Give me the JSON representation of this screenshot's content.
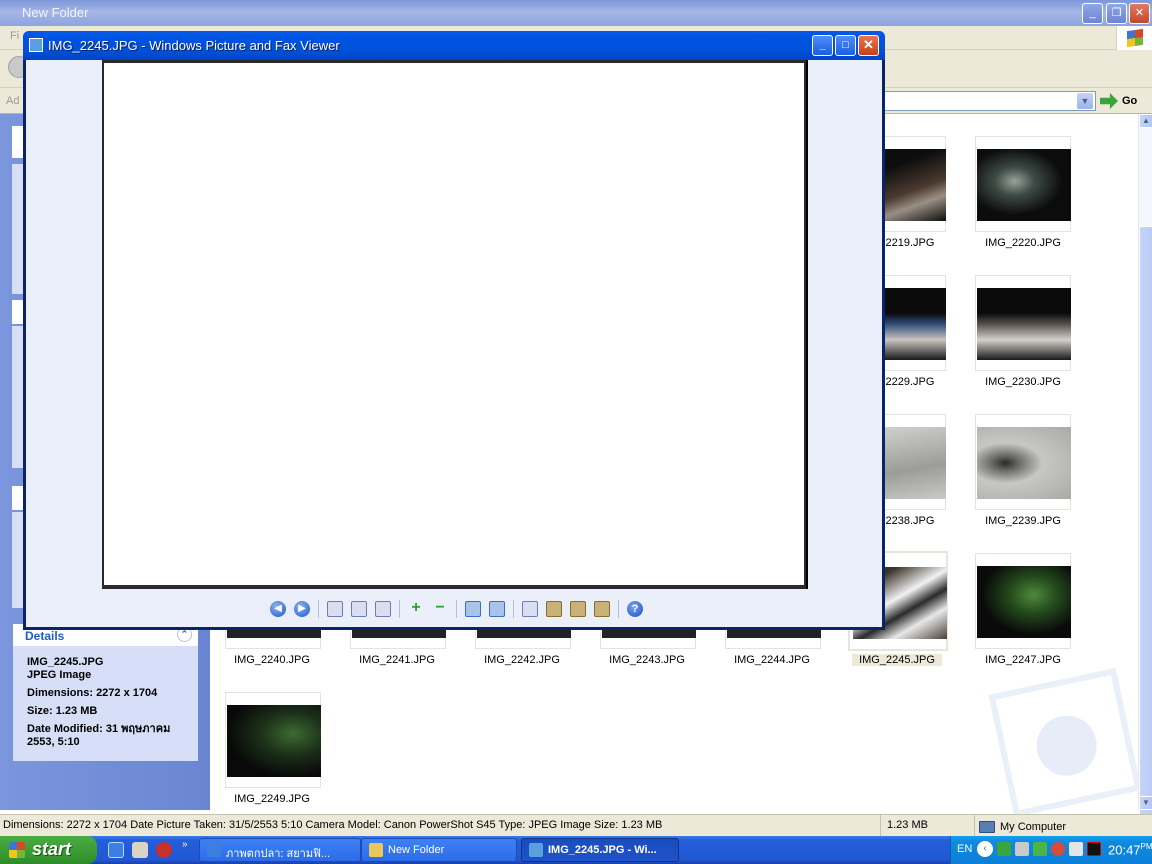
{
  "explorer": {
    "title": "New Folder",
    "menu_fragment": "Fi",
    "address_fragment": "Ad",
    "go_label": "Go",
    "window_controls": [
      "minimize",
      "restore",
      "close"
    ]
  },
  "details": {
    "header": "Details",
    "filename": "IMG_2245.JPG",
    "filetype": "JPEG Image",
    "dimensions": "Dimensions: 2272 x 1704",
    "size": "Size: 1.23 MB",
    "date_modified": "Date Modified: 31 พฤษภาคม 2553, 5:10"
  },
  "thumbnails": [
    {
      "label": "2219.JPG"
    },
    {
      "label": "IMG_2220.JPG"
    },
    {
      "label": "2229.JPG"
    },
    {
      "label": "IMG_2230.JPG"
    },
    {
      "label": "2238.JPG"
    },
    {
      "label": "IMG_2239.JPG"
    },
    {
      "label": "IMG_2240.JPG"
    },
    {
      "label": "IMG_2241.JPG"
    },
    {
      "label": "IMG_2242.JPG"
    },
    {
      "label": "IMG_2243.JPG"
    },
    {
      "label": "IMG_2244.JPG"
    },
    {
      "label": "IMG_2245.JPG",
      "selected": true
    },
    {
      "label": "IMG_2247.JPG"
    },
    {
      "label": "IMG_2249.JPG"
    }
  ],
  "statusbar": {
    "text": "Dimensions: 2272 x 1704 Date Picture Taken: 31/5/2553 5:10 Camera Model: Canon PowerShot S45 Type: JPEG Image Size: 1.23 MB",
    "size": "1.23 MB",
    "zone": "My Computer"
  },
  "viewer": {
    "title": "IMG_2245.JPG - Windows Picture and Fax Viewer",
    "toolbar": [
      "previous-image",
      "next-image",
      "best-fit",
      "actual-size",
      "slideshow",
      "zoom-in",
      "zoom-out",
      "rotate-clockwise",
      "rotate-counterclockwise",
      "delete",
      "print",
      "copy-to",
      "edit",
      "help"
    ]
  },
  "taskbar": {
    "start_label": "start",
    "tasks": [
      {
        "label": "ภาพตกปลา: สยามฟิ..."
      },
      {
        "label": "New Folder"
      },
      {
        "label": "IMG_2245.JPG - Wi...",
        "active": true
      }
    ],
    "language": "EN",
    "clock": "20:47",
    "clock_suffix": "PM"
  }
}
